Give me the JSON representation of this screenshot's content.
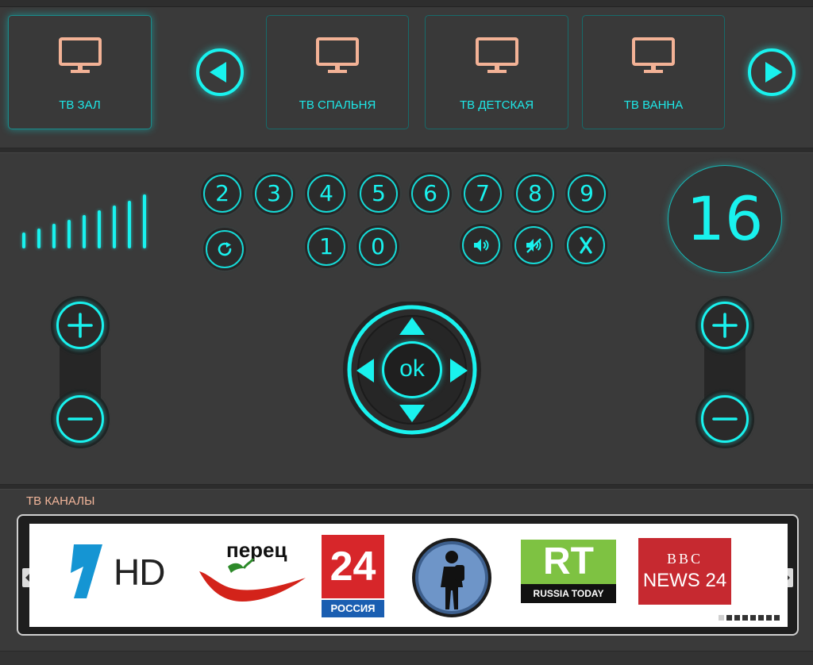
{
  "tv_rooms": [
    {
      "label": "ТВ ЗАЛ",
      "active": true
    },
    {
      "label": "ТВ СПАЛЬНЯ",
      "active": false
    },
    {
      "label": "ТВ ДЕТСКАЯ",
      "active": false
    },
    {
      "label": "ТВ ВАННА",
      "active": false
    }
  ],
  "volume_level": {
    "bars_total": 9
  },
  "number_buttons_row1": [
    "2",
    "3",
    "4",
    "5",
    "6",
    "7",
    "8",
    "9"
  ],
  "number_buttons_row2": [
    "1",
    "0"
  ],
  "channel_display": "16",
  "dpad": {
    "ok_label": "ok"
  },
  "channels_section": {
    "title": "ТВ КАНАЛЫ",
    "logos": [
      {
        "name": "Первый HD",
        "text": "HD"
      },
      {
        "name": "Перец",
        "text": "перец"
      },
      {
        "name": "Россия 24",
        "text_top": "24",
        "text_bottom": "РОССИЯ"
      },
      {
        "name": "Travel silhouette channel"
      },
      {
        "name": "RT",
        "text_top": "RT",
        "text_bottom": "RUSSIA TODAY"
      },
      {
        "name": "BBC News 24",
        "text_top": "BBC",
        "text_bottom": "NEWS 24"
      }
    ],
    "pager": {
      "pages": 8,
      "current": 1
    }
  },
  "colors": {
    "accent": "#19f2ee",
    "background": "#3a3a3a",
    "tv_icon": "#f3b296",
    "section_title": "#f1b59a"
  }
}
